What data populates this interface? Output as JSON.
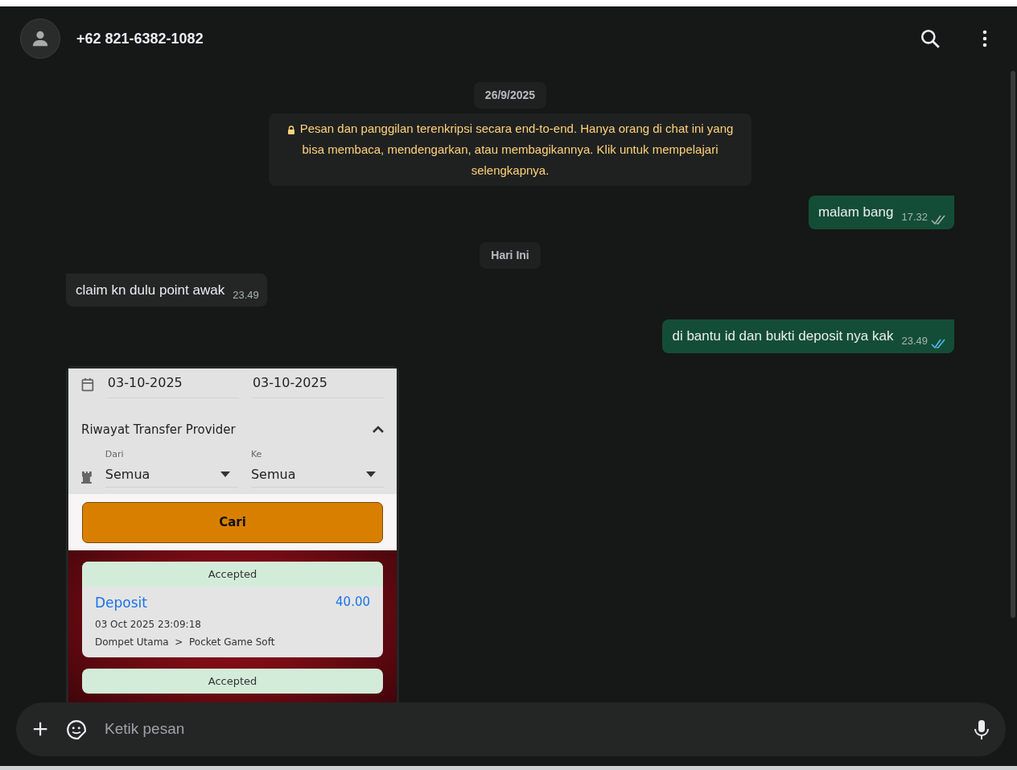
{
  "header": {
    "contact": "+62 821-6382-1082"
  },
  "messages": [
    {
      "kind": "date",
      "text": "26/9/2025"
    },
    {
      "kind": "notice",
      "text": "Pesan dan panggilan terenkripsi secara end-to-end. Hanya orang di chat ini yang bisa membaca, mendengarkan, atau membagikannya. Klik untuk mempelajari selengkapnya."
    },
    {
      "kind": "out",
      "text": "malam bang",
      "time": "17.32",
      "read": false
    },
    {
      "kind": "date",
      "text": "Hari Ini"
    },
    {
      "kind": "in",
      "text": "claim kn dulu point awak",
      "time": "23.49"
    },
    {
      "kind": "out",
      "text": "di bantu id dan bukti deposit nya kak",
      "time": "23.49",
      "read": true
    },
    {
      "kind": "image",
      "screen": {
        "dates": [
          "03-10-2025",
          "03-10-2025"
        ],
        "section_title": "Riwayat Transfer Provider",
        "expanded": true,
        "filters": [
          {
            "label": "Dari",
            "value": "Semua"
          },
          {
            "label": "Ke",
            "value": "Semua"
          }
        ],
        "search_button": "Cari",
        "transactions": [
          {
            "status": "Accepted",
            "type": "Deposit",
            "amount": "40.00",
            "datetime": "03 Oct 2025 23:09:18",
            "route": "Dompet Utama  >  Pocket Game Soft"
          },
          {
            "status": "Accepted"
          }
        ]
      }
    }
  ],
  "composer": {
    "placeholder": "Ketik pesan"
  }
}
